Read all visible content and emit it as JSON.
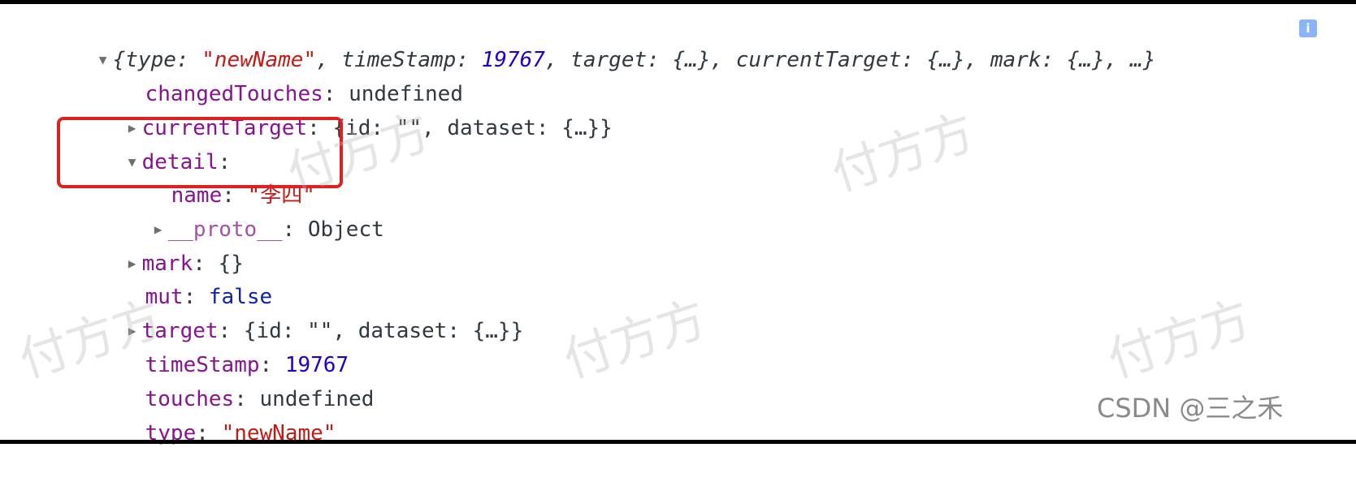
{
  "console": {
    "summary": {
      "open_brace": "{",
      "type_key": "type",
      "type_value": "\"newName\"",
      "timestamp_key": "timeStamp",
      "timestamp_value": "19767",
      "target_key": "target",
      "target_value": "{…}",
      "current_target_key": "currentTarget",
      "current_target_value": "{…}",
      "mark_key": "mark",
      "mark_value": "{…}",
      "ellipsis": "…}",
      "colon": ":",
      "comma": ",",
      "info_icon": "i"
    },
    "properties": {
      "changed_touches": {
        "key": "changedTouches",
        "value": "undefined"
      },
      "current_target": {
        "key": "currentTarget",
        "value": "{id: \"\", dataset: {…}}"
      },
      "detail": {
        "key": "detail"
      },
      "detail_name": {
        "key": "name",
        "value": "\"李四\""
      },
      "proto": {
        "key": "__proto__",
        "value": "Object"
      },
      "mark": {
        "key": "mark",
        "value": "{}"
      },
      "mut": {
        "key": "mut",
        "value": "false"
      },
      "target": {
        "key": "target",
        "value": "{id: \"\", dataset: {…}}"
      },
      "timestamp": {
        "key": "timeStamp",
        "value": "19767"
      },
      "touches": {
        "key": "touches",
        "value": "undefined"
      },
      "type": {
        "key": "type",
        "value": "\"newName\""
      }
    },
    "colon": ":"
  },
  "watermark_text": "付方方",
  "credit": "CSDN @三之禾",
  "colors": {
    "key": "#881391",
    "string": "#c41a16",
    "number": "#1c00cf",
    "boolean": "#0d22aa",
    "highlight": "#e02020"
  }
}
